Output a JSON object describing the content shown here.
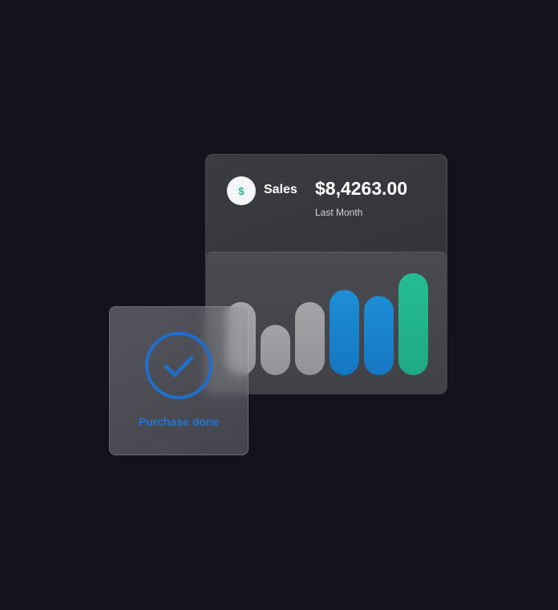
{
  "sales": {
    "label": "Sales",
    "amount": "$8,4263.00",
    "period": "Last Month",
    "icon": "dollar-icon",
    "currency_symbol": "$"
  },
  "chart_data": {
    "type": "bar",
    "values": [
      0.48,
      0.33,
      0.48,
      0.56,
      0.52,
      0.67
    ],
    "colors": [
      "#9c9da1",
      "#9c9da1",
      "#9c9da1",
      "#1a86cf",
      "#1a86cf",
      "#22b48f"
    ]
  },
  "purchase": {
    "label": "Purchase done",
    "icon": "check-circle-icon",
    "accent": "#2175d6"
  }
}
